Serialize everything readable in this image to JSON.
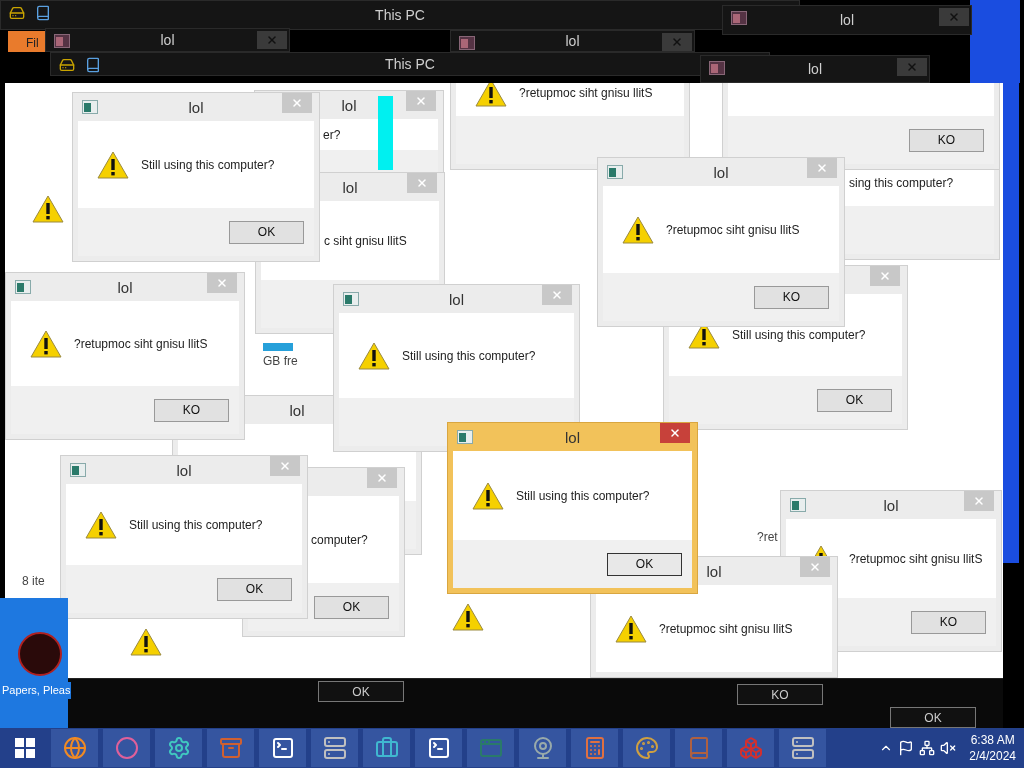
{
  "top_bars": [
    {
      "kind": "explorer",
      "title": "This PC"
    },
    {
      "kind": "dialog",
      "title": "lol"
    },
    {
      "kind": "dialog",
      "title": "lol"
    },
    {
      "kind": "explorer",
      "title": "This PC"
    },
    {
      "kind": "dialog",
      "title": "lol"
    },
    {
      "kind": "dialog",
      "title": "lol"
    }
  ],
  "ribbon_tab": "Fil",
  "fragments": [
    "8 ite",
    "GB fre",
    "?ret"
  ],
  "dialogs": [
    {
      "title": "lol",
      "message": "er?",
      "active": false
    },
    {
      "title": "lol",
      "message": "c siht gnisu llitS",
      "active": false
    },
    {
      "message": "sing this computer?",
      "active": false
    },
    {
      "message": "?retupmoc siht gnisu llitS",
      "active": false
    },
    {
      "button": "KO",
      "active": false
    },
    {
      "title": "lol",
      "message": "Still using this computer?",
      "button": "OK",
      "active": false
    },
    {
      "title": "lol",
      "active": false
    },
    {
      "title": "lol",
      "message": "?retupmoc siht gnisu llitS",
      "button": "KO",
      "active": false
    },
    {
      "message": "computer?",
      "button": "OK",
      "active": false
    },
    {
      "message": "Still using this computer?",
      "button": "OK",
      "active": false
    },
    {
      "title": "lol",
      "message": "Still using this computer?",
      "active": false
    },
    {
      "title": "lol",
      "message": "?retupmoc siht gnisu llitS",
      "button": "KO",
      "active": false
    },
    {
      "title": "lol",
      "message": "Still using this computer?",
      "button": "OK",
      "active": false
    },
    {
      "title": "lol",
      "message": "?retupmoc siht gnisu llitS",
      "button": "KO",
      "active": false
    },
    {
      "title": "lol",
      "message": "?retupmoc siht gnisu llitS",
      "active": false
    },
    {
      "title": "lol",
      "message": "Still using this computer?",
      "button": "OK",
      "active": true
    }
  ],
  "bottom_buttons": [
    "OK",
    "KO",
    "OK"
  ],
  "desktop_icon": {
    "label": "Papers, Pleas"
  },
  "clock": {
    "time": "6:38 AM",
    "date": "2/4/2024"
  }
}
